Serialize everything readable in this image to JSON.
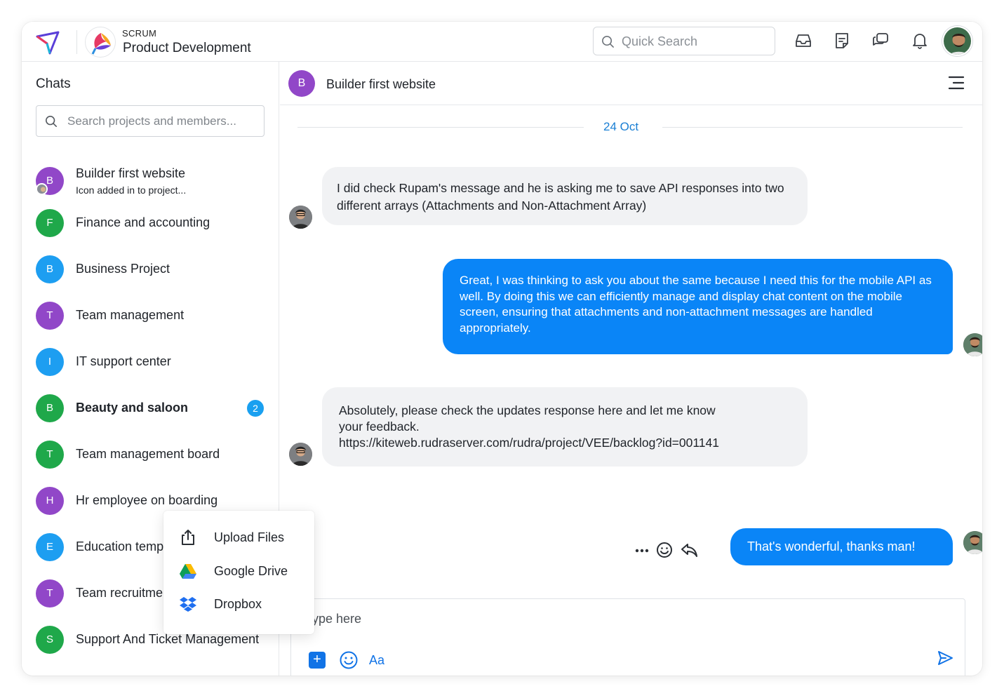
{
  "topbar": {
    "project_sub": "SCRUM",
    "project_title": "Product Development",
    "quick_search_placeholder": "Quick Search",
    "icons": [
      "inbox-icon",
      "notes-icon",
      "chat-icon",
      "bell-icon"
    ]
  },
  "sidebar": {
    "title": "Chats",
    "search_placeholder": "Search projects and members...",
    "items": [
      {
        "initial": "B",
        "name": "Builder first website",
        "sub": "Icon added in to project...",
        "color": "#9147c8"
      },
      {
        "initial": "F",
        "name": "Finance and accounting",
        "color": "#1fa84a"
      },
      {
        "initial": "B",
        "name": "Business Project",
        "color": "#1d9ef1"
      },
      {
        "initial": "T",
        "name": "Team management",
        "color": "#9147c8"
      },
      {
        "initial": "I",
        "name": "IT support center",
        "color": "#1d9ef1"
      },
      {
        "initial": "B",
        "name": "Beauty and saloon",
        "badge": "2",
        "color": "#1fa84a"
      },
      {
        "initial": "T",
        "name": "Team management  board",
        "color": "#1fa84a"
      },
      {
        "initial": "H",
        "name": "Hr employee on boarding",
        "color": "#9147c8"
      },
      {
        "initial": "E",
        "name": "Education temp",
        "color": "#1d9ef1"
      },
      {
        "initial": "T",
        "name": "Team recruitme",
        "color": "#9147c8"
      },
      {
        "initial": "S",
        "name": "Support And Ticket Management",
        "color": "#1fa84a"
      }
    ]
  },
  "chat": {
    "header_initial": "B",
    "header_title": "Builder first website",
    "date": "24 Oct",
    "messages": [
      {
        "direction": "in",
        "text": "I did check Rupam's message and he is asking me to save API responses into two different arrays (Attachments and Non-Attachment Array)"
      },
      {
        "direction": "out",
        "text": "Great, I was thinking to ask you about the same because I need this for the mobile API as well. By doing this we can efficiently manage and display chat content on the mobile screen, ensuring that attachments and non-attachment messages are handled appropriately."
      },
      {
        "direction": "in",
        "line1": "Absolutely, please check the updates response here and let me know",
        "line2": "your feedback.",
        "line3": "https://kiteweb.rudraserver.com/rudra/project/VEE/backlog?id=001141"
      },
      {
        "direction": "out",
        "text": "That's wonderful, thanks man!"
      }
    ],
    "composer_placeholder": "Type here",
    "composer_format": "Aa"
  },
  "attach_menu": {
    "items": [
      {
        "label": "Upload Files",
        "icon": "upload-icon"
      },
      {
        "label": "Google Drive",
        "icon": "google-drive-icon"
      },
      {
        "label": "Dropbox",
        "icon": "dropbox-icon"
      }
    ]
  },
  "colors": {
    "accent": "#0a85f7",
    "date": "#1a7fd4",
    "badge": "#1aa0f0"
  }
}
